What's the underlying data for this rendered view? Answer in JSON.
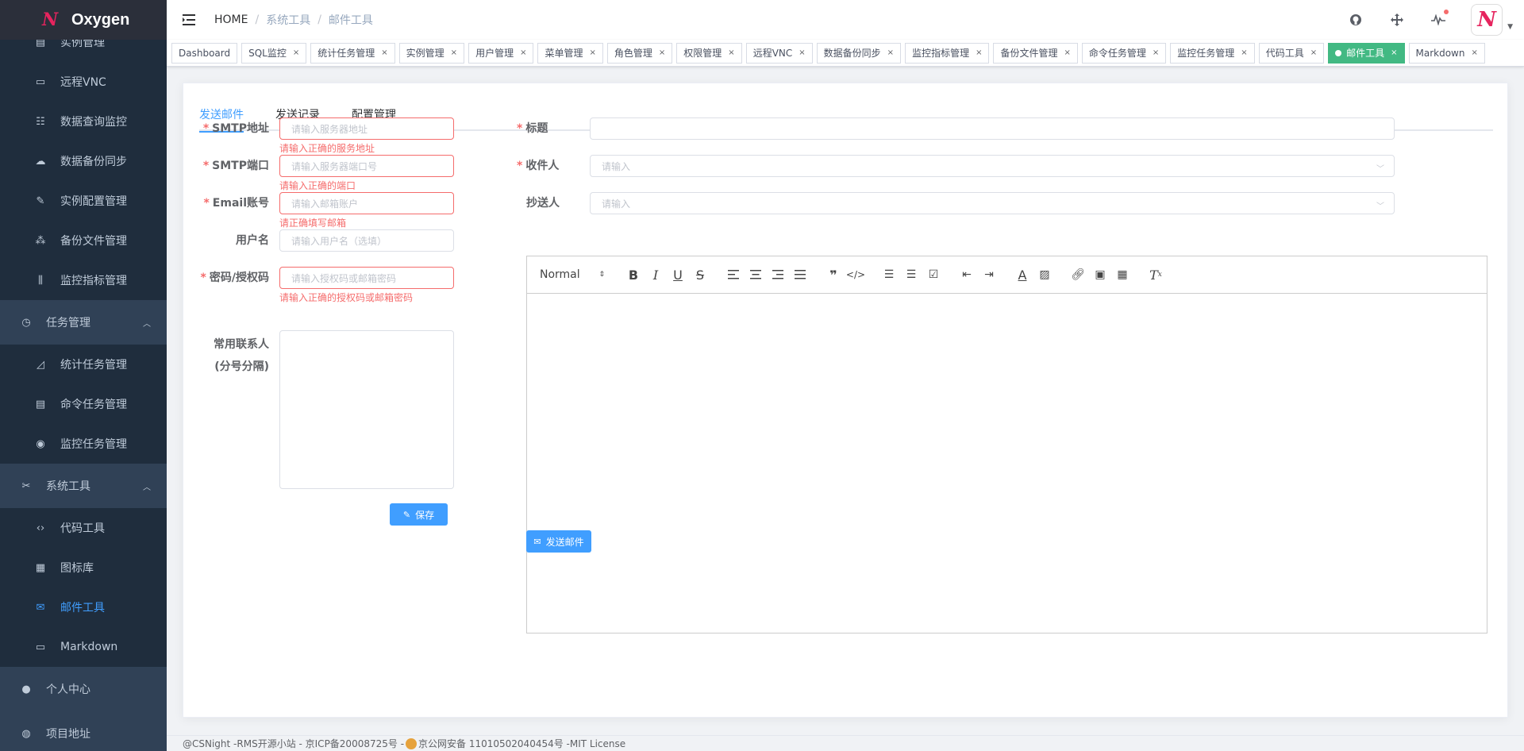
{
  "app": {
    "name": "Oxygen"
  },
  "sidebar": {
    "items": [
      {
        "label": "实例管理",
        "icon": "list-icon",
        "type": "sub"
      },
      {
        "label": "远程VNC",
        "icon": "monitor-icon",
        "type": "sub"
      },
      {
        "label": "数据查询监控",
        "icon": "list-check-icon",
        "type": "sub"
      },
      {
        "label": "数据备份同步",
        "icon": "cloud-download-icon",
        "type": "sub"
      },
      {
        "label": "实例配置管理",
        "icon": "wrench-icon",
        "type": "sub"
      },
      {
        "label": "备份文件管理",
        "icon": "cubes-icon",
        "type": "sub"
      },
      {
        "label": "监控指标管理",
        "icon": "sliders-icon",
        "type": "sub"
      },
      {
        "label": "任务管理",
        "icon": "stopwatch-icon",
        "type": "top"
      },
      {
        "label": "统计任务管理",
        "icon": "chart-icon",
        "type": "sub"
      },
      {
        "label": "命令任务管理",
        "icon": "server-icon",
        "type": "sub"
      },
      {
        "label": "监控任务管理",
        "icon": "radar-icon",
        "type": "sub"
      },
      {
        "label": "系统工具",
        "icon": "tools-icon",
        "type": "top"
      },
      {
        "label": "代码工具",
        "icon": "code-icon",
        "type": "sub"
      },
      {
        "label": "图标库",
        "icon": "grid-icon",
        "type": "sub"
      },
      {
        "label": "邮件工具",
        "icon": "envelope-icon",
        "type": "sub",
        "active": true
      },
      {
        "label": "Markdown",
        "icon": "markdown-icon",
        "type": "sub"
      },
      {
        "label": "个人中心",
        "icon": "user-icon",
        "type": "top"
      },
      {
        "label": "项目地址",
        "icon": "github-icon",
        "type": "top"
      }
    ]
  },
  "breadcrumb": {
    "home": "HOME",
    "level1": "系统工具",
    "level2": "邮件工具"
  },
  "tags": [
    {
      "label": "Dashboard",
      "closable": false
    },
    {
      "label": "SQL监控",
      "closable": true
    },
    {
      "label": "统计任务管理",
      "closable": true
    },
    {
      "label": "实例管理",
      "closable": true
    },
    {
      "label": "用户管理",
      "closable": true
    },
    {
      "label": "菜单管理",
      "closable": true
    },
    {
      "label": "角色管理",
      "closable": true
    },
    {
      "label": "权限管理",
      "closable": true
    },
    {
      "label": "远程VNC",
      "closable": true
    },
    {
      "label": "数据备份同步",
      "closable": true
    },
    {
      "label": "监控指标管理",
      "closable": true
    },
    {
      "label": "备份文件管理",
      "closable": true
    },
    {
      "label": "命令任务管理",
      "closable": true
    },
    {
      "label": "监控任务管理",
      "closable": true
    },
    {
      "label": "代码工具",
      "closable": true
    },
    {
      "label": "邮件工具",
      "closable": true,
      "active": true
    },
    {
      "label": "Markdown",
      "closable": true
    }
  ],
  "tabs": [
    "发送邮件",
    "发送记录",
    "配置管理"
  ],
  "config_form": {
    "smtp_host": {
      "label": "SMTP地址",
      "placeholder": "请输入服务器地址",
      "error": "请输入正确的服务地址"
    },
    "smtp_port": {
      "label": "SMTP端口",
      "placeholder": "请输入服务器端口号",
      "error": "请输入正确的端口"
    },
    "email": {
      "label": "Email账号",
      "placeholder": "请输入邮箱账户",
      "error": "请正确填写邮箱"
    },
    "username": {
      "label": "用户名",
      "placeholder": "请输入用户名（选填）"
    },
    "password": {
      "label": "密码/授权码",
      "placeholder": "请输入授权码或邮箱密码",
      "error": "请输入正确的授权码或邮箱密码"
    },
    "contacts": {
      "label_line1": "常用联系人",
      "label_line2": "(分号分隔)"
    },
    "save_label": "保存"
  },
  "mail_form": {
    "subject": {
      "label": "标题",
      "value": ""
    },
    "to": {
      "label": "收件人",
      "placeholder": "请输入"
    },
    "cc": {
      "label": "抄送人",
      "placeholder": "请输入"
    },
    "editor_format": "Normal",
    "send_label": "发送邮件"
  },
  "footer": {
    "text": "@CSNight -RMS开源小站 - 京ICP备20008725号 -",
    "police": "京公网安备 11010502040454号 -MIT License"
  },
  "colors": {
    "primary": "#409eff",
    "sidebar_bg": "#304156",
    "active_tag": "#42b983",
    "error": "#f56c6c"
  }
}
